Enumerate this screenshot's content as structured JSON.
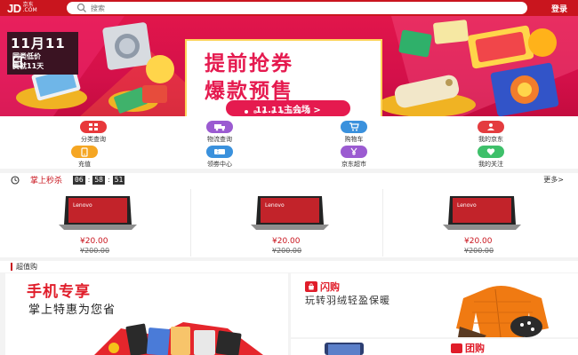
{
  "header": {
    "logo_main": "JD",
    "logo_cn": "京东",
    "logo_com": ".COM",
    "search_placeholder": "搜索",
    "login_label": "登录"
  },
  "banner": {
    "tag_big": "11月11日",
    "tag_line1": "同类低价",
    "tag_line2": "贵就11天",
    "headline_line1": "提前抢券",
    "headline_line2": "爆款预售",
    "cta_label": "11.11主会场 >"
  },
  "quick_nav": [
    {
      "label": "分类查询",
      "icon": "grid-icon",
      "color": "#e8383b"
    },
    {
      "label": "物流查询",
      "icon": "truck-icon",
      "color": "#9b5bd1"
    },
    {
      "label": "购物车",
      "icon": "cart-icon",
      "color": "#3a91dd"
    },
    {
      "label": "我的京东",
      "icon": "user-icon",
      "color": "#e43c3f"
    },
    {
      "label": "充值",
      "icon": "phone-icon",
      "color": "#f5a623"
    },
    {
      "label": "领劵中心",
      "icon": "coupon-icon",
      "color": "#3a91dd"
    },
    {
      "label": "京东超市",
      "icon": "yen-icon",
      "color": "#9b5bd1"
    },
    {
      "label": "我的关注",
      "icon": "heart-icon",
      "color": "#3ec06a"
    }
  ],
  "seckill": {
    "title": "掌上秒杀",
    "countdown": [
      "06",
      "58",
      "51"
    ],
    "more_label": "更多>",
    "items": [
      {
        "price": "¥20.00",
        "old_price": "¥200.00",
        "brand": "Lenovo"
      },
      {
        "price": "¥20.00",
        "old_price": "¥200.00",
        "brand": "Lenovo"
      },
      {
        "price": "¥20.00",
        "old_price": "¥200.00",
        "brand": "Lenovo"
      }
    ]
  },
  "chaozhigou": {
    "title": "超值购",
    "left_title": "手机专享",
    "left_sub": "掌上特惠为您省",
    "right_title": "闪购",
    "right_sub": "玩转羽绒轻盈保暖",
    "bottom_title": "团购"
  },
  "colors": {
    "brand_red": "#c9151e",
    "banner_pink": "#e1164b"
  }
}
